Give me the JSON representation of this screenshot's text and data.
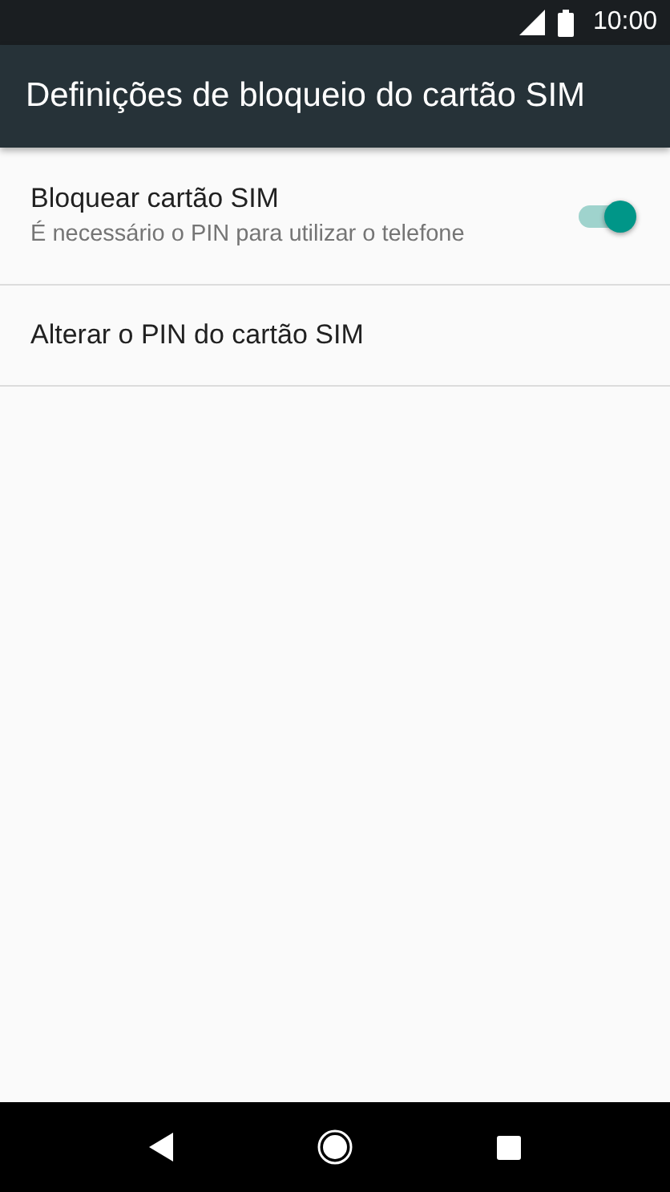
{
  "status_bar": {
    "time": "10:00"
  },
  "app_bar": {
    "title": "Definições de bloqueio do cartão SIM"
  },
  "settings": [
    {
      "kind": "switch",
      "title": "Bloquear cartão SIM",
      "summary": "É necessário o PIN para utilizar o telefone",
      "on": true
    },
    {
      "kind": "plain",
      "title": "Alterar o PIN do cartão SIM"
    }
  ]
}
